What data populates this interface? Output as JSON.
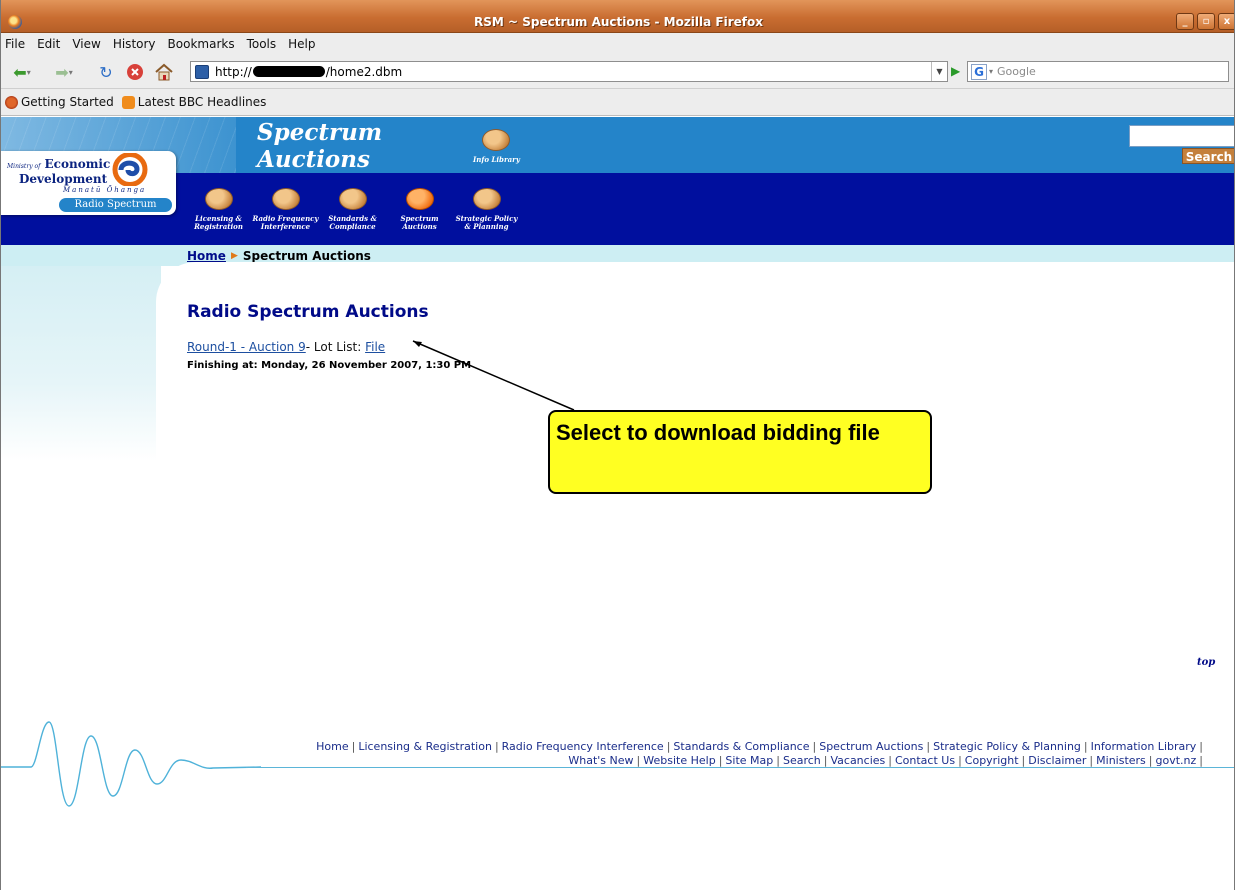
{
  "window": {
    "title": "RSM ~ Spectrum Auctions - Mozilla Firefox",
    "buttons": [
      "_",
      "▫",
      "x"
    ]
  },
  "menu": [
    "File",
    "Edit",
    "View",
    "History",
    "Bookmarks",
    "Tools",
    "Help"
  ],
  "address": {
    "prefix": "http://",
    "suffix": "/home2.dbm"
  },
  "search": {
    "placeholder": "Google"
  },
  "bookmarks": [
    {
      "label": "Getting Started",
      "icon": "firefox-icon"
    },
    {
      "label": "Latest BBC Headlines",
      "icon": "rss-icon"
    }
  ],
  "site": {
    "ministry_small": "Ministry of",
    "ministry_line1": "Economic",
    "ministry_line2": "Development",
    "maori": "Manatū Ōhanga",
    "radio_spectrum": "Radio Spectrum",
    "title_line1": "Spectrum",
    "title_line2": "Auctions",
    "info_library": "Info Library",
    "nav": [
      {
        "label": "Licensing &\nRegistration",
        "active": false
      },
      {
        "label": "Radio Frequency\nInterference",
        "active": false
      },
      {
        "label": "Standards &\nCompliance",
        "active": false
      },
      {
        "label": "Spectrum\nAuctions",
        "active": true
      },
      {
        "label": "Strategic Policy\n& Planning",
        "active": false
      }
    ],
    "search_button": "Search"
  },
  "breadcrumb": {
    "home": "Home",
    "current": "Spectrum Auctions"
  },
  "content": {
    "title": "Radio Spectrum Auctions",
    "auction_link": "Round-1 - Auction 9",
    "lot_list_label": "- Lot List: ",
    "file_link": "File",
    "finishing": "Finishing at: Monday, 26 November 2007, 1:30 PM"
  },
  "callout": {
    "text": "Select to download bidding file"
  },
  "top_link": "top",
  "footer": {
    "line1": [
      "Home",
      "Licensing & Registration",
      "Radio Frequency Interference",
      "Standards & Compliance",
      "Spectrum Auctions",
      "Strategic Policy & Planning",
      "Information Library"
    ],
    "line2": [
      "What's New",
      "Website Help",
      "Site Map",
      "Search",
      "Vacancies",
      "Contact Us",
      "Copyright",
      "Disclaimer",
      "Ministers",
      "govt.nz"
    ]
  },
  "colors": {
    "header_blue": "#2484c9",
    "nav_navy": "#000f9e",
    "callout_yellow": "#ffff22",
    "accent_orange": "#f06d10"
  }
}
